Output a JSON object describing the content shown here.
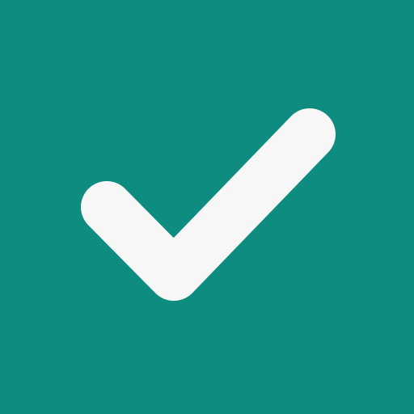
{
  "icon": {
    "name": "checkmark-icon",
    "background_color": "#0E8C80",
    "mark_color": "#F7F7F7"
  }
}
